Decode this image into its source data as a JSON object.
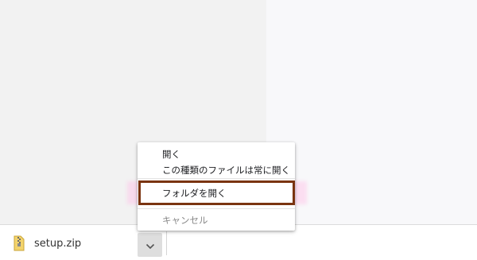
{
  "download_bar": {
    "file_name": "setup.zip",
    "file_icon": "zip-file-icon",
    "menu_button_icon": "chevron-down-icon"
  },
  "context_menu": {
    "items": [
      {
        "label": "開く",
        "enabled": true
      },
      {
        "label": "この種類のファイルは常に開く",
        "enabled": true
      },
      {
        "label": "フォルダを開く",
        "enabled": true,
        "highlighted": true
      },
      {
        "label": "キャンセル",
        "enabled": false
      }
    ]
  },
  "colors": {
    "highlight_border": "#7a3410",
    "highlight_glow": "#ffbee6",
    "menu_button_bg": "#dedede"
  }
}
